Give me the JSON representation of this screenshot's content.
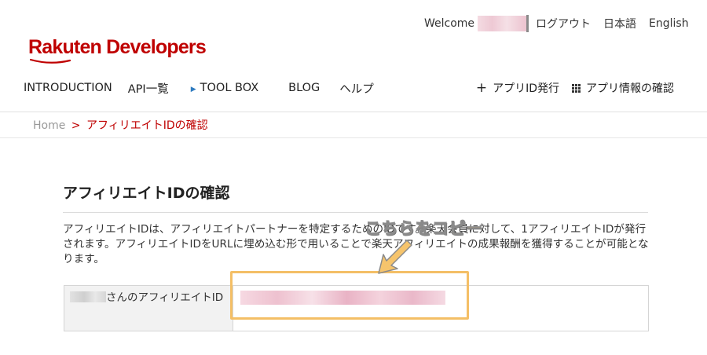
{
  "header": {
    "welcome_label": "Welcome",
    "links": [
      "ログアウト",
      "日本語",
      "English"
    ],
    "logo_text": "Rakuten Developers"
  },
  "nav": {
    "items": [
      "INTRODUCTION",
      "API一覧",
      "TOOL BOX",
      "BLOG",
      "ヘルプ"
    ],
    "right": [
      "アプリID発行",
      "アプリ情報の確認"
    ]
  },
  "breadcrumb": {
    "home": "Home",
    "separator": ">",
    "current": "アフィリエイトIDの確認"
  },
  "main": {
    "title": "アフィリエイトIDの確認",
    "description": "アフィリエイトIDは、アフィリエイトパートナーを特定するためのIDです。楽天会員に対して、1アフィリエイトIDが発行されます。アフィリエイトIDをURLに埋め込む形で用いることで楽天アフィリエイトの成果報酬を獲得することが可能となります。",
    "id_label": "さんのアフィリエイトID"
  },
  "annotation": {
    "callout": "こちらをコピー"
  },
  "colors": {
    "brand_red": "#bf0000",
    "highlight": "#f4bf66",
    "callout_fill": "#f6c46c"
  }
}
